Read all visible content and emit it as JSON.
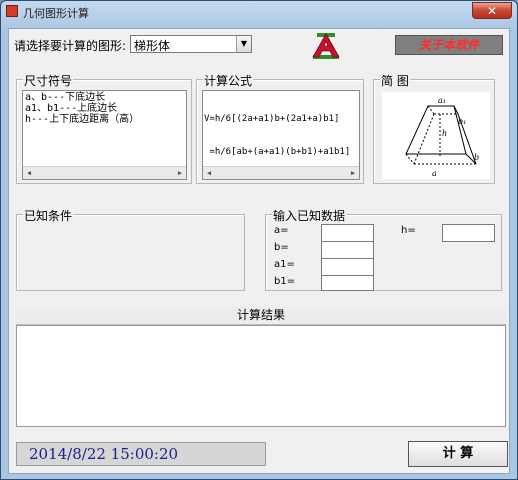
{
  "window": {
    "title": "几何图形计算",
    "close_glyph": "✕"
  },
  "shape_select": {
    "label": "请选择要计算的图形:",
    "value": "梯形体",
    "arrow": "▼"
  },
  "about_button": {
    "label": "关于本软件"
  },
  "dimensions_group": {
    "caption": "尺寸符号",
    "lines": [
      "a、b---下底边长",
      "a1、b1---上底边长",
      "h---上下底边距离（高）"
    ]
  },
  "formula_group": {
    "caption": "计算公式",
    "lines": [
      "V=h/6[(2a+a1)b+(2a1+a)b1]",
      " =h/6[ab+(a+a1)(b+b1)+a1b1]"
    ]
  },
  "diagram_group": {
    "caption": "简 图",
    "labels": {
      "a1": "a₁",
      "b1": "b₁",
      "h": "h",
      "a": "a",
      "b": "b"
    }
  },
  "known_conditions_group": {
    "caption": "已知条件"
  },
  "input_group": {
    "caption": "输入已知数据",
    "fields": [
      {
        "label": "a=",
        "value": ""
      },
      {
        "label": "b=",
        "value": ""
      },
      {
        "label": "a1=",
        "value": ""
      },
      {
        "label": "b1=",
        "value": ""
      },
      {
        "label": "h=",
        "value": ""
      }
    ]
  },
  "result": {
    "header": "计算结果",
    "value": ""
  },
  "status": {
    "datetime": "2014/8/22  15:00:20"
  },
  "calc_button": {
    "label": "计 算"
  },
  "colors": {
    "about_text": "#ff2a2a",
    "logo_red": "#c8102e",
    "logo_green": "#2e8b2e",
    "status_text": "#20208a"
  },
  "icons": [
    "app-icon",
    "close-icon",
    "logo-icon",
    "dropdown-arrow-icon",
    "scroll-left-icon",
    "scroll-right-icon",
    "frustum-diagram"
  ]
}
